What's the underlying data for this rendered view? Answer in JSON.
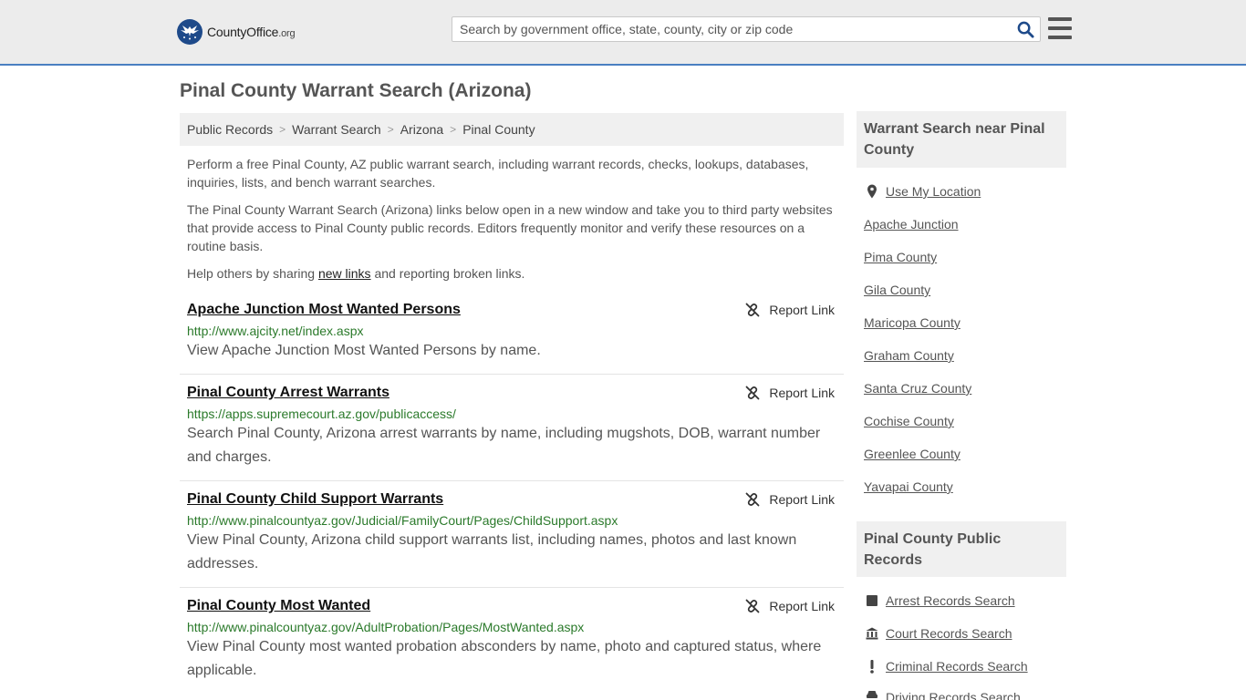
{
  "header": {
    "logo_main": "CountyOffice",
    "logo_ext": ".org",
    "search_placeholder": "Search by government office, state, county, city or zip code",
    "search_value": ""
  },
  "page": {
    "title": "Pinal County Warrant Search (Arizona)"
  },
  "breadcrumb": [
    "Public Records",
    "Warrant Search",
    "Arizona",
    "Pinal County"
  ],
  "intro": {
    "p1": "Perform a free Pinal County, AZ public warrant search, including warrant records, checks, lookups, databases, inquiries, lists, and bench warrant searches.",
    "p2": "The Pinal County Warrant Search (Arizona) links below open in a new window and take you to third party websites that provide access to Pinal County public records. Editors frequently monitor and verify these resources on a routine basis.",
    "p3_before": "Help others by sharing ",
    "p3_link": "new links",
    "p3_after": " and reporting broken links."
  },
  "report_label": "Report Link",
  "results": [
    {
      "title": "Apache Junction Most Wanted Persons",
      "url": "http://www.ajcity.net/index.aspx",
      "desc": "View Apache Junction Most Wanted Persons by name."
    },
    {
      "title": "Pinal County Arrest Warrants",
      "url": "https://apps.supremecourt.az.gov/publicaccess/",
      "desc": "Search Pinal County, Arizona arrest warrants by name, including mugshots, DOB, warrant number and charges."
    },
    {
      "title": "Pinal County Child Support Warrants",
      "url": "http://www.pinalcountyaz.gov/Judicial/FamilyCourt/Pages/ChildSupport.aspx",
      "desc": "View Pinal County, Arizona child support warrants list, including names, photos and last known addresses."
    },
    {
      "title": "Pinal County Most Wanted",
      "url": "http://www.pinalcountyaz.gov/AdultProbation/Pages/MostWanted.aspx",
      "desc": "View Pinal County most wanted probation absconders by name, photo and captured status, where applicable."
    }
  ],
  "sidebar": {
    "nearby_heading": "Warrant Search near Pinal County",
    "use_location": "Use My Location",
    "nearby": [
      "Apache Junction",
      "Pima County",
      "Gila County",
      "Maricopa County",
      "Graham County",
      "Santa Cruz County",
      "Cochise County",
      "Greenlee County",
      "Yavapai County"
    ],
    "records_heading": "Pinal County Public Records",
    "records": [
      {
        "label": "Arrest Records Search",
        "icon": "square-icon"
      },
      {
        "label": "Court Records Search",
        "icon": "courthouse-icon"
      },
      {
        "label": "Criminal Records Search",
        "icon": "exclamation-icon"
      },
      {
        "label": "Driving Records Search",
        "icon": "car-icon"
      }
    ]
  },
  "colors": {
    "accent_line": "#4a7fc1",
    "logo_blue": "#1e4a8a",
    "url_green": "#2b7a2b"
  }
}
